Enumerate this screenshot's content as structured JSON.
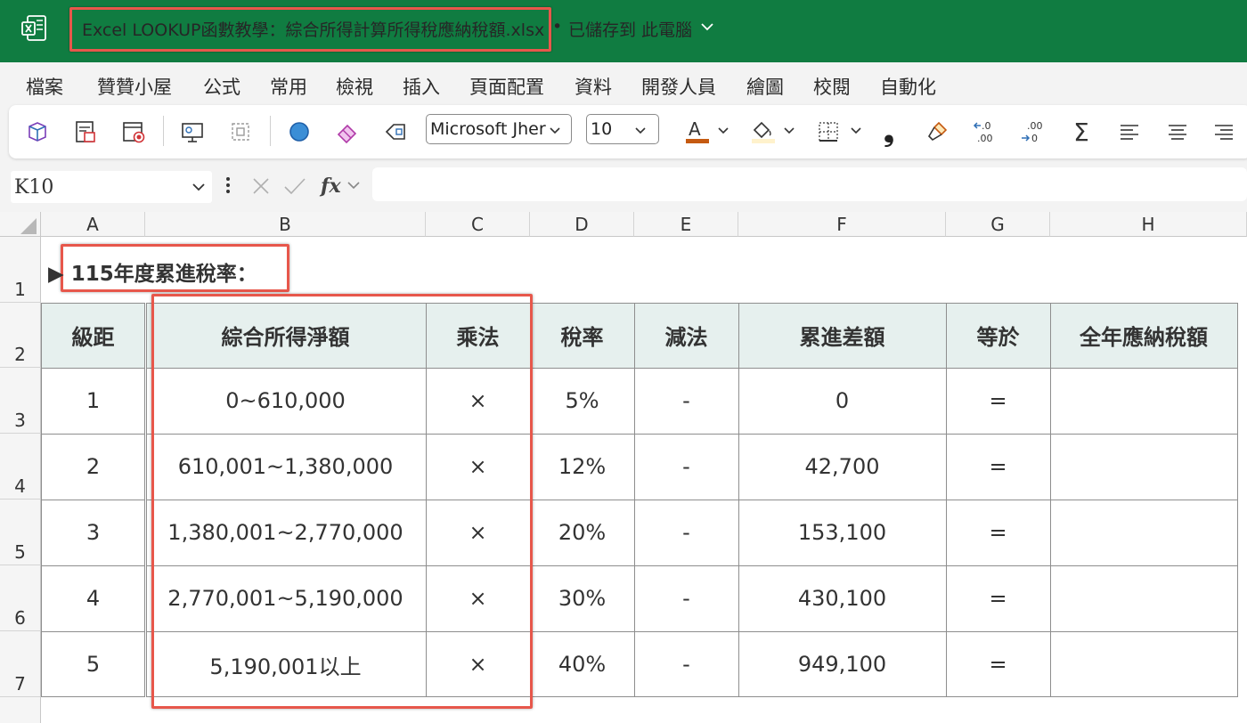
{
  "window": {
    "title": "Excel LOOKUP函數教學：綜合所得計算所得稅應納稅額.xlsx",
    "separator": "•",
    "save_status": "已儲存到 此電腦"
  },
  "menu": [
    "檔案",
    "贊贊小屋",
    "公式",
    "常用",
    "檢視",
    "插入",
    "頁面配置",
    "資料",
    "開發人員",
    "繪圖",
    "校閱",
    "自動化"
  ],
  "toolbar": {
    "font_name": "Microsoft Jher",
    "font_size": "10",
    "font_color": "#c55a11",
    "fill_color": "#fff2cc",
    "comma_glyph": "❟",
    "sum_glyph": "Σ",
    "inc_decimal": [
      ".0",
      ".00"
    ],
    "dec_decimal": [
      ".00",
      "0"
    ]
  },
  "formula_bar": {
    "name_box": "K10",
    "fx_label": "fx",
    "value": ""
  },
  "sheet": {
    "columns": [
      "A",
      "B",
      "C",
      "D",
      "E",
      "F",
      "G",
      "H"
    ],
    "rows": [
      "1",
      "2",
      "3",
      "4",
      "5",
      "6",
      "7"
    ],
    "heading_marker": "▶",
    "heading": "115年度累進稅率：",
    "table": {
      "headers": [
        "級距",
        "綜合所得淨額",
        "乘法",
        "稅率",
        "減法",
        "累進差額",
        "等於",
        "全年應納稅額"
      ],
      "rows": [
        [
          "1",
          "0~610,000",
          "×",
          "5%",
          "-",
          "0",
          "=",
          ""
        ],
        [
          "2",
          "610,001~1,380,000",
          "×",
          "12%",
          "-",
          "42,700",
          "=",
          ""
        ],
        [
          "3",
          "1,380,001~2,770,000",
          "×",
          "20%",
          "-",
          "153,100",
          "=",
          ""
        ],
        [
          "4",
          "2,770,001~5,190,000",
          "×",
          "30%",
          "-",
          "430,100",
          "=",
          ""
        ],
        [
          "5",
          "5,190,001以上",
          "×",
          "40%",
          "-",
          "949,100",
          "=",
          ""
        ]
      ]
    }
  },
  "colors": {
    "titlebar": "#107c41",
    "annotation": "#e7574b",
    "table_header_fill": "#e6f0ee"
  }
}
